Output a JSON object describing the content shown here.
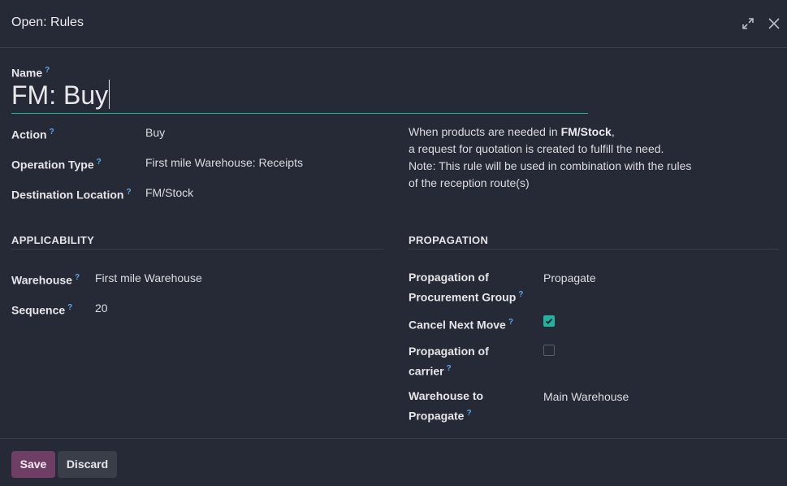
{
  "dialog": {
    "title": "Open: Rules"
  },
  "icons": {
    "expand": "expand-icon",
    "close": "close-icon",
    "help": "?"
  },
  "form": {
    "name_label": "Name",
    "name_value": "FM: Buy",
    "action_label": "Action",
    "action_value": "Buy",
    "operation_type_label": "Operation Type",
    "operation_type_value": "First mile Warehouse: Receipts",
    "destination_label": "Destination Location",
    "destination_value": "FM/Stock",
    "help": {
      "line1_prefix": "When products are needed in ",
      "line1_bold": "FM/Stock",
      "line1_suffix": ",",
      "line2": "a request for quotation is created to fulfill the need.",
      "line3": "Note: This rule will be used in combination with the rules",
      "line4": "of the reception route(s)"
    }
  },
  "applicability": {
    "title": "APPLICABILITY",
    "warehouse_label": "Warehouse",
    "warehouse_value": "First mile Warehouse",
    "sequence_label": "Sequence",
    "sequence_value": "20"
  },
  "propagation": {
    "title": "PROPAGATION",
    "group_label_line1": "Propagation of",
    "group_label_line2": "Procurement Group",
    "group_value": "Propagate",
    "cancel_next_label": "Cancel Next Move",
    "cancel_next_checked": true,
    "carrier_label_line1": "Propagation of",
    "carrier_label_line2": "carrier",
    "carrier_checked": false,
    "warehouse_to_label_line1": "Warehouse to",
    "warehouse_to_label_line2": "Propagate",
    "warehouse_to_value": "Main Warehouse"
  },
  "footer": {
    "save_label": "Save",
    "discard_label": "Discard"
  },
  "colors": {
    "background": "#262a36",
    "accent": "#21b3a0",
    "primary_button": "#6e3e66",
    "help_marker": "#5aa9e6"
  }
}
